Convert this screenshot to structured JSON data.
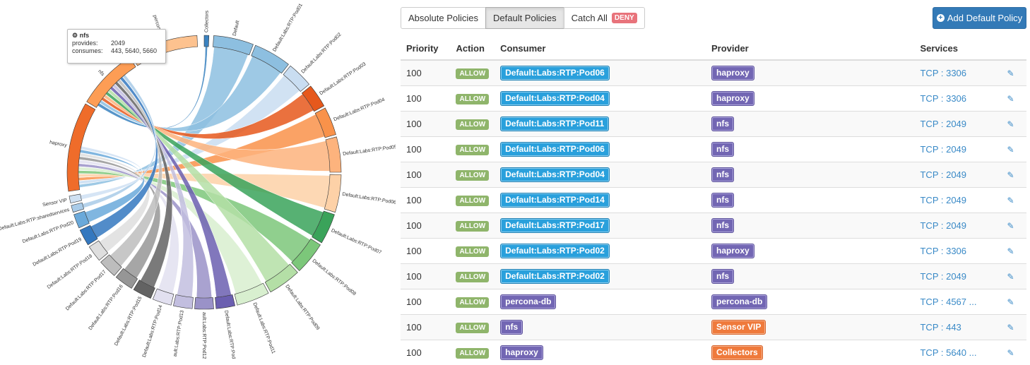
{
  "chord": {
    "segments": [
      {
        "label": "Collectors",
        "color": "#3a82c0",
        "start": 0,
        "end": 2
      },
      {
        "label": "Default",
        "color": "#8dbfe0",
        "start": 4,
        "end": 21
      },
      {
        "label": "Default:Labs:RTP:Pod01",
        "color": "#8dbfe0",
        "start": 22,
        "end": 38
      },
      {
        "label": "Default:Labs:RTP:Pod02",
        "color": "#c9ddf1",
        "start": 39,
        "end": 50
      },
      {
        "label": "Default:Labs:RTP:Pod03",
        "color": "#e6581c",
        "start": 51,
        "end": 61
      },
      {
        "label": "Default:Labs:RTP:Pod04",
        "color": "#f9924a",
        "start": 62,
        "end": 74
      },
      {
        "label": "Default:Labs:RTP:Pod05",
        "color": "#fdb37d",
        "start": 75,
        "end": 90
      },
      {
        "label": "Default:Labs:RTP:Pod06",
        "color": "#fdd1a7",
        "start": 91,
        "end": 107
      },
      {
        "label": "Default:Labs:RTP:Pod07",
        "color": "#3aa35a",
        "start": 108,
        "end": 121
      },
      {
        "label": "Default:Labs:RTP:Pod08",
        "color": "#7cc77a",
        "start": 122,
        "end": 136
      },
      {
        "label": "Default:Labs:RTP:Pod09",
        "color": "#b4dfa6",
        "start": 137,
        "end": 151
      },
      {
        "label": "Default:Labs:RTP:Pod11",
        "color": "#d8efcf",
        "start": 152,
        "end": 166
      },
      {
        "label": "Default:Labs:RTP:Pod",
        "color": "#6b5fb0",
        "start": 167,
        "end": 175
      },
      {
        "label": "ault:Labs:RTP:Pod12",
        "color": "#9a92c8",
        "start": 176,
        "end": 184
      },
      {
        "label": "ault:Labs:RTP:Pod13",
        "color": "#c2bedf",
        "start": 185,
        "end": 193
      },
      {
        "label": "Default:Labs:RTP:Pod14",
        "color": "#e2e0f0",
        "start": 194,
        "end": 202
      },
      {
        "label": "Default:Labs:RTP:Pod15",
        "color": "#636363",
        "start": 203,
        "end": 211
      },
      {
        "label": "Default:Labs:RTP:Pod16",
        "color": "#969696",
        "start": 212,
        "end": 220
      },
      {
        "label": "Default:Labs:RTP:Pod17",
        "color": "#bdbdbd",
        "start": 221,
        "end": 229
      },
      {
        "label": "Default:Labs:RTP:Pod18",
        "color": "#dedede",
        "start": 230,
        "end": 237
      },
      {
        "label": "Default:Labs:RTP:Pod19",
        "color": "#3478bf",
        "start": 238,
        "end": 245
      },
      {
        "label": "Default:Labs:RTP:Pod20",
        "color": "#6aa9da",
        "start": 246,
        "end": 252
      },
      {
        "label": "Default:Labs:RTP:sharedservices",
        "color": "#a9cbe8",
        "start": 253,
        "end": 256
      },
      {
        "label": "Sensor VIP",
        "color": "#cfe1f3",
        "start": 257,
        "end": 260
      },
      {
        "label": "haproxy",
        "color": "#ef6c2a",
        "start": 262,
        "end": 300
      },
      {
        "label": "nfs",
        "color": "#fd9d55",
        "start": 301,
        "end": 327
      },
      {
        "label": "percona-db",
        "color": "#fdc28f",
        "start": 328,
        "end": 357
      }
    ]
  },
  "tooltip": {
    "icon": "servers-icon",
    "title": "nfs",
    "provides_label": "provides:",
    "provides_value": "2049",
    "consumes_label": "consumes:",
    "consumes_value": "443, 5640, 5660"
  },
  "tabs": {
    "absolute": "Absolute Policies",
    "default": "Default Policies",
    "catch_all": "Catch All",
    "deny": "DENY"
  },
  "add_button": {
    "icon": "plus-circle-icon",
    "label": "Add Default Policy"
  },
  "table": {
    "headers": [
      "Priority",
      "Action",
      "Consumer",
      "Provider",
      "Services"
    ],
    "rows": [
      {
        "priority": "100",
        "action": "ALLOW",
        "consumer": "Default:Labs:RTP:Pod06",
        "consumer_kind": "app",
        "provider": "haproxy",
        "provider_kind": "svc",
        "service": "TCP : 3306"
      },
      {
        "priority": "100",
        "action": "ALLOW",
        "consumer": "Default:Labs:RTP:Pod04",
        "consumer_kind": "app",
        "provider": "haproxy",
        "provider_kind": "svc",
        "service": "TCP : 3306"
      },
      {
        "priority": "100",
        "action": "ALLOW",
        "consumer": "Default:Labs:RTP:Pod11",
        "consumer_kind": "app",
        "provider": "nfs",
        "provider_kind": "svc",
        "service": "TCP : 2049"
      },
      {
        "priority": "100",
        "action": "ALLOW",
        "consumer": "Default:Labs:RTP:Pod06",
        "consumer_kind": "app",
        "provider": "nfs",
        "provider_kind": "svc",
        "service": "TCP : 2049"
      },
      {
        "priority": "100",
        "action": "ALLOW",
        "consumer": "Default:Labs:RTP:Pod04",
        "consumer_kind": "app",
        "provider": "nfs",
        "provider_kind": "svc",
        "service": "TCP : 2049"
      },
      {
        "priority": "100",
        "action": "ALLOW",
        "consumer": "Default:Labs:RTP:Pod14",
        "consumer_kind": "app",
        "provider": "nfs",
        "provider_kind": "svc",
        "service": "TCP : 2049"
      },
      {
        "priority": "100",
        "action": "ALLOW",
        "consumer": "Default:Labs:RTP:Pod17",
        "consumer_kind": "app",
        "provider": "nfs",
        "provider_kind": "svc",
        "service": "TCP : 2049"
      },
      {
        "priority": "100",
        "action": "ALLOW",
        "consumer": "Default:Labs:RTP:Pod02",
        "consumer_kind": "app",
        "provider": "haproxy",
        "provider_kind": "svc",
        "service": "TCP : 3306"
      },
      {
        "priority": "100",
        "action": "ALLOW",
        "consumer": "Default:Labs:RTP:Pod02",
        "consumer_kind": "app",
        "provider": "nfs",
        "provider_kind": "svc",
        "service": "TCP : 2049"
      },
      {
        "priority": "100",
        "action": "ALLOW",
        "consumer": "percona-db",
        "consumer_kind": "svc",
        "provider": "percona-db",
        "provider_kind": "svc",
        "service": "TCP : 4567 ..."
      },
      {
        "priority": "100",
        "action": "ALLOW",
        "consumer": "nfs",
        "consumer_kind": "svc",
        "provider": "Sensor VIP",
        "provider_kind": "vip",
        "service": "TCP : 443"
      },
      {
        "priority": "100",
        "action": "ALLOW",
        "consumer": "haproxy",
        "consumer_kind": "svc",
        "provider": "Collectors",
        "provider_kind": "vip",
        "service": "TCP : 5640 ..."
      }
    ]
  }
}
